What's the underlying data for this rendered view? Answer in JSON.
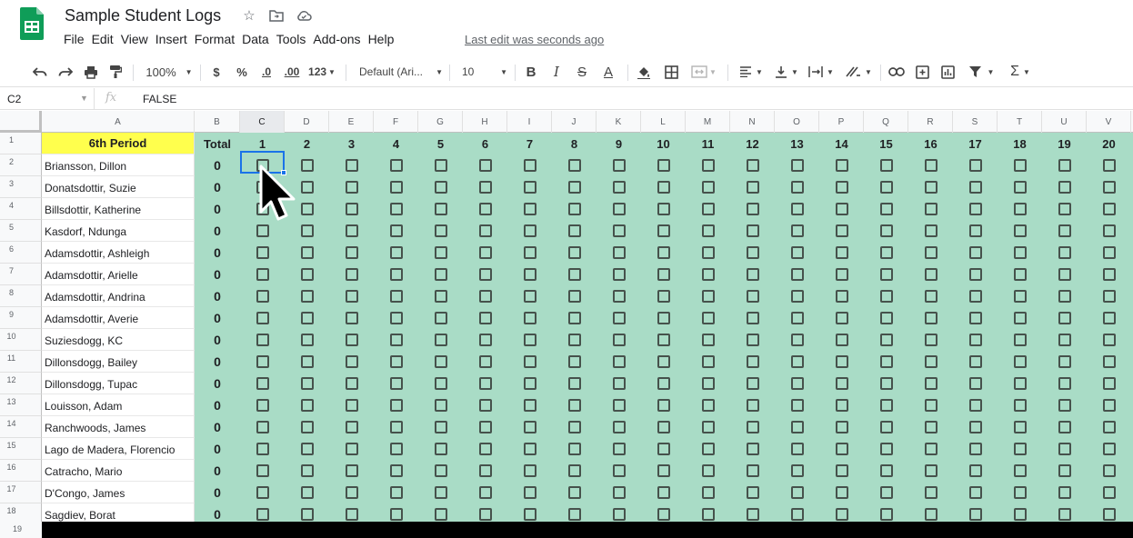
{
  "app": {
    "doc_title": "Sample Student Logs",
    "menu": [
      "File",
      "Edit",
      "View",
      "Insert",
      "Format",
      "Data",
      "Tools",
      "Add-ons",
      "Help"
    ],
    "last_edit": "Last edit was seconds ago",
    "colors": {
      "sheets_green": "#0f9d58",
      "selection_blue": "#1a73e8",
      "header_yellow": "#ffff4d",
      "check_area": "#a9dcc6"
    }
  },
  "toolbar": {
    "zoom": "100%",
    "currency": "$",
    "percent": "%",
    "dec_decrease": ".0",
    "dec_increase": ".00",
    "more_formats": "123",
    "font": "Default (Ari...",
    "font_size": "10",
    "bold": "B",
    "italic": "I",
    "strike": "S",
    "text_color": "A",
    "sum": "Σ"
  },
  "formula_bar": {
    "cell_ref": "C2",
    "fx": "fx",
    "value": "FALSE"
  },
  "sheet": {
    "columns": [
      "A",
      "B",
      "C",
      "D",
      "E",
      "F",
      "G",
      "H",
      "I",
      "J",
      "K",
      "L",
      "M",
      "N",
      "O",
      "P",
      "Q",
      "R",
      "S",
      "T",
      "U",
      "V"
    ],
    "selected_column": "C",
    "header_row": {
      "a": "6th Period",
      "b": "Total",
      "numbers": [
        "1",
        "2",
        "3",
        "4",
        "5",
        "6",
        "7",
        "8",
        "9",
        "10",
        "11",
        "12",
        "13",
        "14",
        "15",
        "16",
        "17",
        "18",
        "19",
        "20"
      ]
    },
    "students": [
      {
        "name": "Briansson, Dillon",
        "total": "0"
      },
      {
        "name": "Donatsdottir, Suzie",
        "total": "0"
      },
      {
        "name": "Billsdottir, Katherine",
        "total": "0"
      },
      {
        "name": "Kasdorf, Ndunga",
        "total": "0"
      },
      {
        "name": "Adamsdottir, Ashleigh",
        "total": "0"
      },
      {
        "name": "Adamsdottir, Arielle",
        "total": "0"
      },
      {
        "name": "Adamsdottir, Andrina",
        "total": "0"
      },
      {
        "name": "Adamsdottir, Averie",
        "total": "0"
      },
      {
        "name": "Suziesdogg, KC",
        "total": "0"
      },
      {
        "name": "Dillonsdogg, Bailey",
        "total": "0"
      },
      {
        "name": "Dillonsdogg, Tupac",
        "total": "0"
      },
      {
        "name": "Louisson, Adam",
        "total": "0"
      },
      {
        "name": "Ranchwoods, James",
        "total": "0"
      },
      {
        "name": "Lago de Madera, Florencio",
        "total": "0"
      },
      {
        "name": "Catracho, Mario",
        "total": "0"
      },
      {
        "name": "D'Congo, James",
        "total": "0"
      },
      {
        "name": "Sagdiev, Borat",
        "total": "0"
      }
    ],
    "row_numbers": [
      "1",
      "2",
      "3",
      "4",
      "5",
      "6",
      "7",
      "8",
      "9",
      "10",
      "11",
      "12",
      "13",
      "14",
      "15",
      "16",
      "17",
      "18",
      "19"
    ]
  }
}
